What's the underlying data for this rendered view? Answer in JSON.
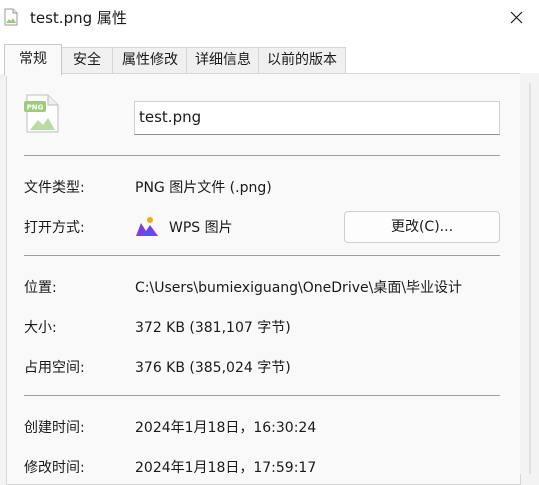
{
  "window": {
    "title": "test.png 属性",
    "close_icon": "close-icon"
  },
  "tabs": [
    {
      "label": "常规",
      "active": true
    },
    {
      "label": "安全",
      "active": false
    },
    {
      "label": "属性修改",
      "active": false
    },
    {
      "label": "详细信息",
      "active": false
    },
    {
      "label": "以前的版本",
      "active": false
    }
  ],
  "general": {
    "file_icon": {
      "name": "png-file-icon",
      "badge": "PNG"
    },
    "file_name": "test.png",
    "type_label": "文件类型:",
    "type_value": "PNG 图片文件 (.png)",
    "opens_with_label": "打开方式:",
    "opens_with_app": "WPS 图片",
    "opens_with_icon": "wps-picture-icon",
    "change_button": "更改(C)...",
    "location_label": "位置:",
    "location_value": "C:\\Users\\bumiexiguang\\OneDrive\\桌面\\毕业设计",
    "size_label": "大小:",
    "size_value": "372 KB (381,107 字节)",
    "size_on_disk_label": "占用空间:",
    "size_on_disk_value": "376 KB (385,024 字节)",
    "created_label": "创建时间:",
    "created_value": "2024年1月18日，16:30:24",
    "modified_label": "修改时间:",
    "modified_value": "2024年1月18日，17:59:17"
  },
  "colors": {
    "accent": "#7b3fe4",
    "icon_green": "#9ccc7a",
    "tab_border": "#d6d6d6",
    "separator": "#9e9e9e"
  }
}
